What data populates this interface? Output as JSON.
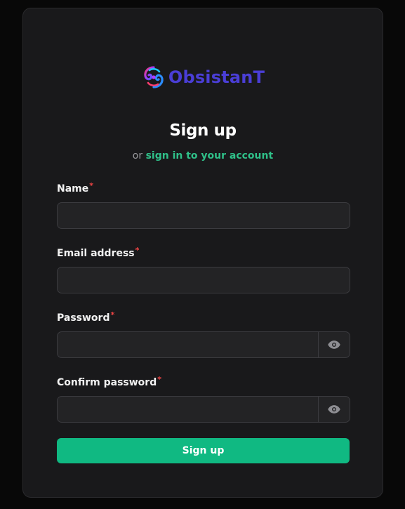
{
  "brand": {
    "name": "ObsistanT",
    "color": "#4a3ed6"
  },
  "header": {
    "title": "Sign up",
    "subtitle_prefix": "or",
    "subtitle_link": "sign in to your account"
  },
  "form": {
    "required_marker": "*",
    "name": {
      "label": "Name",
      "value": ""
    },
    "email": {
      "label": "Email address",
      "value": ""
    },
    "password": {
      "label": "Password",
      "value": "",
      "toggle_icon": "eye-icon"
    },
    "confirm_password": {
      "label": "Confirm password",
      "value": "",
      "toggle_icon": "eye-icon"
    },
    "submit_label": "Sign up"
  },
  "colors": {
    "accent": "#10b982",
    "link": "#2fc089",
    "required": "#ef4444",
    "card_bg": "#19191b",
    "page_bg": "#080808"
  }
}
